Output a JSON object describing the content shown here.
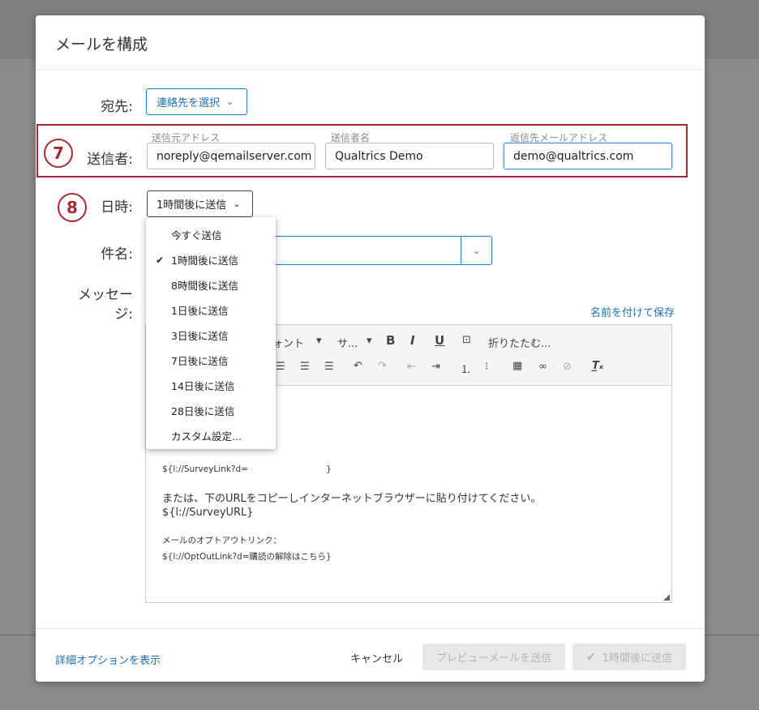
{
  "modal": {
    "title": "メールを構成"
  },
  "recipient": {
    "label": "宛先:",
    "button": "連絡先を選択"
  },
  "sender": {
    "label": "送信者:",
    "marker": "7",
    "from_address": {
      "label": "送信元アドレス",
      "value": "noreply@qemailserver.com"
    },
    "from_name": {
      "label": "送信者名",
      "value": "Qualtrics Demo"
    },
    "reply_to": {
      "label": "返信先メールアドレス",
      "value": "demo@qualtrics.com"
    }
  },
  "schedule": {
    "label": "日時:",
    "marker": "8",
    "selected": "1時間後に送信",
    "options": [
      "今すぐ送信",
      "1時間後に送信",
      "8時間後に送信",
      "1日後に送信",
      "3日後に送信",
      "7日後に送信",
      "14日後に送信",
      "28日後に送信",
      "カスタム設定..."
    ],
    "selected_index": 1
  },
  "subject": {
    "label": "件名:"
  },
  "message": {
    "label_line1": "メッセー",
    "label_line2": "ジ:",
    "save_link": "名前を付けて保存",
    "toolbar": {
      "font": "ォント",
      "size": "サ...",
      "bold": "B",
      "italic": "I",
      "underline": "U",
      "fold": "折りたたむ..."
    },
    "body": {
      "survey_link": "${l://SurveyLink?d=",
      "survey_link_close": "}",
      "copy_instruction": "または、下のURLをコピーしインターネットブラウザーに貼り付けてください。",
      "survey_url": "${l://SurveyURL}",
      "optout_label": "メールのオプトアウトリンク：",
      "optout_link": "${l://OptOutLink?d=購読の解除はこちら}"
    }
  },
  "footer": {
    "advanced": "詳細オプションを表示",
    "cancel": "キャンセル",
    "preview": "プレビューメールを送信",
    "send": "1時間後に送信"
  },
  "colors": {
    "accent": "#1c7dc7",
    "annotation": "#a32a34"
  }
}
